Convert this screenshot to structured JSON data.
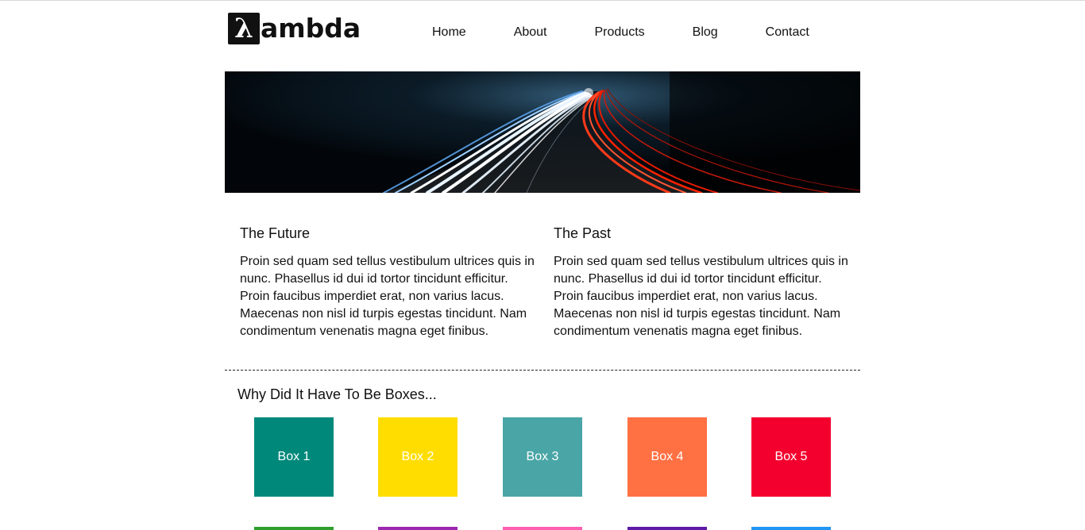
{
  "header": {
    "logo": {
      "mark": "λ",
      "text": "ambda"
    },
    "nav": [
      {
        "label": "Home"
      },
      {
        "label": "About"
      },
      {
        "label": "Products"
      },
      {
        "label": "Blog"
      },
      {
        "label": "Contact"
      }
    ]
  },
  "columns": [
    {
      "title": "The Future",
      "body": "Proin sed quam sed tellus vestibulum ultrices quis in nunc. Phasellus id dui id tortor tincidunt efficitur. Proin faucibus imperdiet erat, non varius lacus. Maecenas non nisl id turpis egestas tincidunt. Nam condimentum venenatis magna eget finibus."
    },
    {
      "title": "The Past",
      "body": "Proin sed quam sed tellus vestibulum ultrices quis in nunc. Phasellus id dui id tortor tincidunt efficitur. Proin faucibus imperdiet erat, non varius lacus. Maecenas non nisl id turpis egestas tincidunt. Nam condimentum venenatis magna eget finibus."
    }
  ],
  "boxes_section": {
    "title": "Why Did It Have To Be Boxes...",
    "boxes": [
      {
        "label": "Box 1",
        "color": "#00897b"
      },
      {
        "label": "Box 2",
        "color": "#ffdd00"
      },
      {
        "label": "Box 3",
        "color": "#4aa6a6"
      },
      {
        "label": "Box 4",
        "color": "#ff7043"
      },
      {
        "label": "Box 5",
        "color": "#f4002f"
      }
    ],
    "next_row_colors": [
      "#2e9e2e",
      "#9c27b0",
      "#ff5fb0",
      "#5e1aa8",
      "#2196f3"
    ]
  }
}
